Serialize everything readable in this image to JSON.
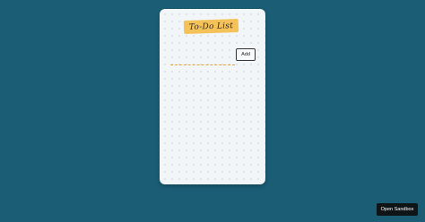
{
  "app": {
    "title": "To-Do List"
  },
  "todo_form": {
    "input_value": "",
    "input_placeholder": "",
    "add_label": "Add"
  },
  "todo_list": {
    "items": []
  },
  "sandbox": {
    "open_label": "Open Sandbox"
  },
  "colors": {
    "page_background": "#1a5d75",
    "card_background": "#f3f6f8",
    "title_badge": "#f5c25a",
    "input_underline": "#e6a43a",
    "sandbox_button": "#0f1416"
  }
}
